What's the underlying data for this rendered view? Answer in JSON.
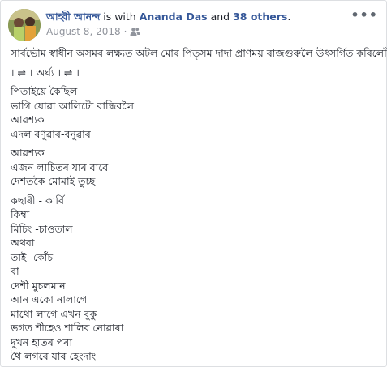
{
  "post": {
    "author": "আহ্বী আনন্দ",
    "with_text": " is with ",
    "tagged_person": "Ananda Das",
    "and_text": " and ",
    "others": "38 others",
    "period": ".",
    "date": "August 8, 2018",
    "separator": "·",
    "audience_icon": "friends-icon",
    "more_icon": "•••"
  },
  "lines": [
    "সাৰ্বভৌম স্বাধীন অসমৰ লক্ষ্যত অটল মোৰ পিতৃসম দাদা প্ৰাণময় ৰাজগুৰুলৈ উৎসৰ্গিত কৰিলোঁ ।",
    "",
    "। ⇌ । অৰ্ঘ্য । ⇌ ।",
    "",
    "পিতাইয়ে কৈছিল --",
    "ভাগি যোৱা আলিটো বান্ধিবলৈ",
    "আৱশ্যক",
    "এদল ৰণুৱাৰ-বনুৱাৰ",
    "",
    "আৱশ্যক",
    "এজন লাচিতৰ যাৰ বাবে",
    "দেশতকৈ মোমাই তুচ্ছ",
    "",
    "কছাৰী - কাৰ্বি",
    "কিম্বা",
    "মিচিং -চাওতাল",
    "অথবা",
    "তাই -কোঁচ",
    "বা",
    "দেশী মুচলমান",
    "আন একো নালাগে",
    "মাথো লাগে এখন বুকু",
    "ভগত শীহেও শালিব নোৱাৰা",
    "দুখন হাতৰ পৰা",
    "থৈ লগৰে যাৰ হেংদাং"
  ]
}
